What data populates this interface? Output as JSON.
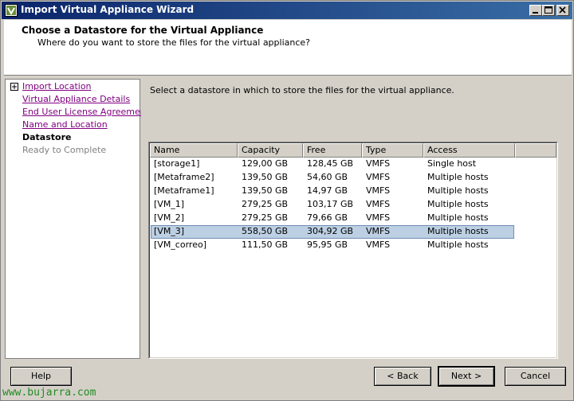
{
  "window": {
    "title": "Import Virtual Appliance Wizard"
  },
  "header": {
    "title": "Choose a Datastore for the Virtual Appliance",
    "subtitle": "Where do you want to store the files for the virtual appliance?"
  },
  "nav": {
    "items": [
      {
        "label": "Import Location",
        "state": "visited"
      },
      {
        "label": "Virtual Appliance Details",
        "state": "visited"
      },
      {
        "label": "End User License Agreement",
        "state": "visited"
      },
      {
        "label": "Name and Location",
        "state": "visited"
      },
      {
        "label": "Datastore",
        "state": "current"
      },
      {
        "label": "Ready to Complete",
        "state": "pending"
      }
    ]
  },
  "content": {
    "instruction": "Select a datastore in which to store the files for the virtual appliance."
  },
  "table": {
    "columns": [
      "Name",
      "Capacity",
      "Free",
      "Type",
      "Access"
    ],
    "rows": [
      {
        "name": "[storage1]",
        "capacity": "129,00 GB",
        "free": "128,45 GB",
        "type": "VMFS",
        "access": "Single host",
        "selected": false
      },
      {
        "name": "[Metaframe2]",
        "capacity": "139,50 GB",
        "free": "54,60 GB",
        "type": "VMFS",
        "access": "Multiple hosts",
        "selected": false
      },
      {
        "name": "[Metaframe1]",
        "capacity": "139,50 GB",
        "free": "14,97 GB",
        "type": "VMFS",
        "access": "Multiple hosts",
        "selected": false
      },
      {
        "name": "[VM_1]",
        "capacity": "279,25 GB",
        "free": "103,17 GB",
        "type": "VMFS",
        "access": "Multiple hosts",
        "selected": false
      },
      {
        "name": "[VM_2]",
        "capacity": "279,25 GB",
        "free": "79,66 GB",
        "type": "VMFS",
        "access": "Multiple hosts",
        "selected": false
      },
      {
        "name": "[VM_3]",
        "capacity": "558,50 GB",
        "free": "304,92 GB",
        "type": "VMFS",
        "access": "Multiple hosts",
        "selected": true
      },
      {
        "name": "[VM_correo]",
        "capacity": "111,50 GB",
        "free": "95,95 GB",
        "type": "VMFS",
        "access": "Multiple hosts",
        "selected": false
      }
    ]
  },
  "buttons": {
    "help": "Help",
    "back": "< Back",
    "next": "Next >",
    "cancel": "Cancel"
  },
  "watermark": "www.bujarra.com",
  "colors": {
    "titlebar_start": "#0a246a",
    "titlebar_end": "#3a6ea5",
    "selection": "#bccfe3",
    "link_visited": "#800080",
    "watermark": "#228b22"
  }
}
